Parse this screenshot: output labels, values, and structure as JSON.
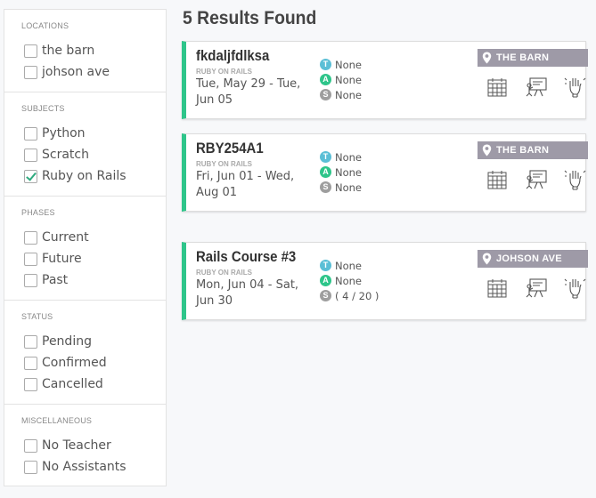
{
  "filters": [
    {
      "heading": "LOCATIONS",
      "options": [
        {
          "label": "the barn",
          "checked": false
        },
        {
          "label": "johson ave",
          "checked": false
        }
      ]
    },
    {
      "heading": "SUBJECTS",
      "options": [
        {
          "label": "Python",
          "checked": false
        },
        {
          "label": "Scratch",
          "checked": false
        },
        {
          "label": "Ruby on Rails",
          "checked": true
        }
      ]
    },
    {
      "heading": "PHASES",
      "options": [
        {
          "label": "Current",
          "checked": false
        },
        {
          "label": "Future",
          "checked": false
        },
        {
          "label": "Past",
          "checked": false
        }
      ]
    },
    {
      "heading": "STATUS",
      "options": [
        {
          "label": "Pending",
          "checked": false
        },
        {
          "label": "Confirmed",
          "checked": false
        },
        {
          "label": "Cancelled",
          "checked": false
        }
      ]
    },
    {
      "heading": "MISCELLANEOUS",
      "options": [
        {
          "label": "No Teacher",
          "checked": false
        },
        {
          "label": "No Assistants",
          "checked": false
        }
      ]
    }
  ],
  "results": {
    "title": "5 Results Found",
    "cards": [
      {
        "name": "fkdaljfdlksa",
        "subject": "RUBY ON RAILS",
        "date_line1": "Tue, May 29 - Tue,",
        "date_line2": "Jun 05",
        "teacher": {
          "letter": "T",
          "value": "None"
        },
        "assistant": {
          "letter": "A",
          "value": "None"
        },
        "students": {
          "letter": "S",
          "value": "None"
        },
        "location": "THE BARN"
      },
      {
        "name": "RBY254A1",
        "subject": "RUBY ON RAILS",
        "date_line1": "Fri, Jun 01 - Wed,",
        "date_line2": "Aug 01",
        "teacher": {
          "letter": "T",
          "value": "None"
        },
        "assistant": {
          "letter": "A",
          "value": "None"
        },
        "students": {
          "letter": "S",
          "value": "None"
        },
        "location": "THE BARN"
      },
      {
        "name": "Rails Course #3",
        "subject": "RUBY ON RAILS",
        "date_line1": "Mon, Jun 04 - Sat,",
        "date_line2": "Jun 30",
        "teacher": {
          "letter": "T",
          "value": "None"
        },
        "assistant": {
          "letter": "A",
          "value": "None"
        },
        "students": {
          "letter": "S",
          "value": "( 4 / 20 )"
        },
        "location": "JOHSON AVE"
      }
    ]
  },
  "icons": {
    "card_actions": [
      "calendar-grid-icon",
      "presentation-board-icon",
      "raised-hand-icon"
    ],
    "location": "map-pin-icon"
  },
  "colors": {
    "accent": "#2ec58a",
    "teacher": "#5bbfd6",
    "assistant": "#2ec58a",
    "students": "#9e9e9e",
    "location_bar": "#9e9aa7"
  }
}
